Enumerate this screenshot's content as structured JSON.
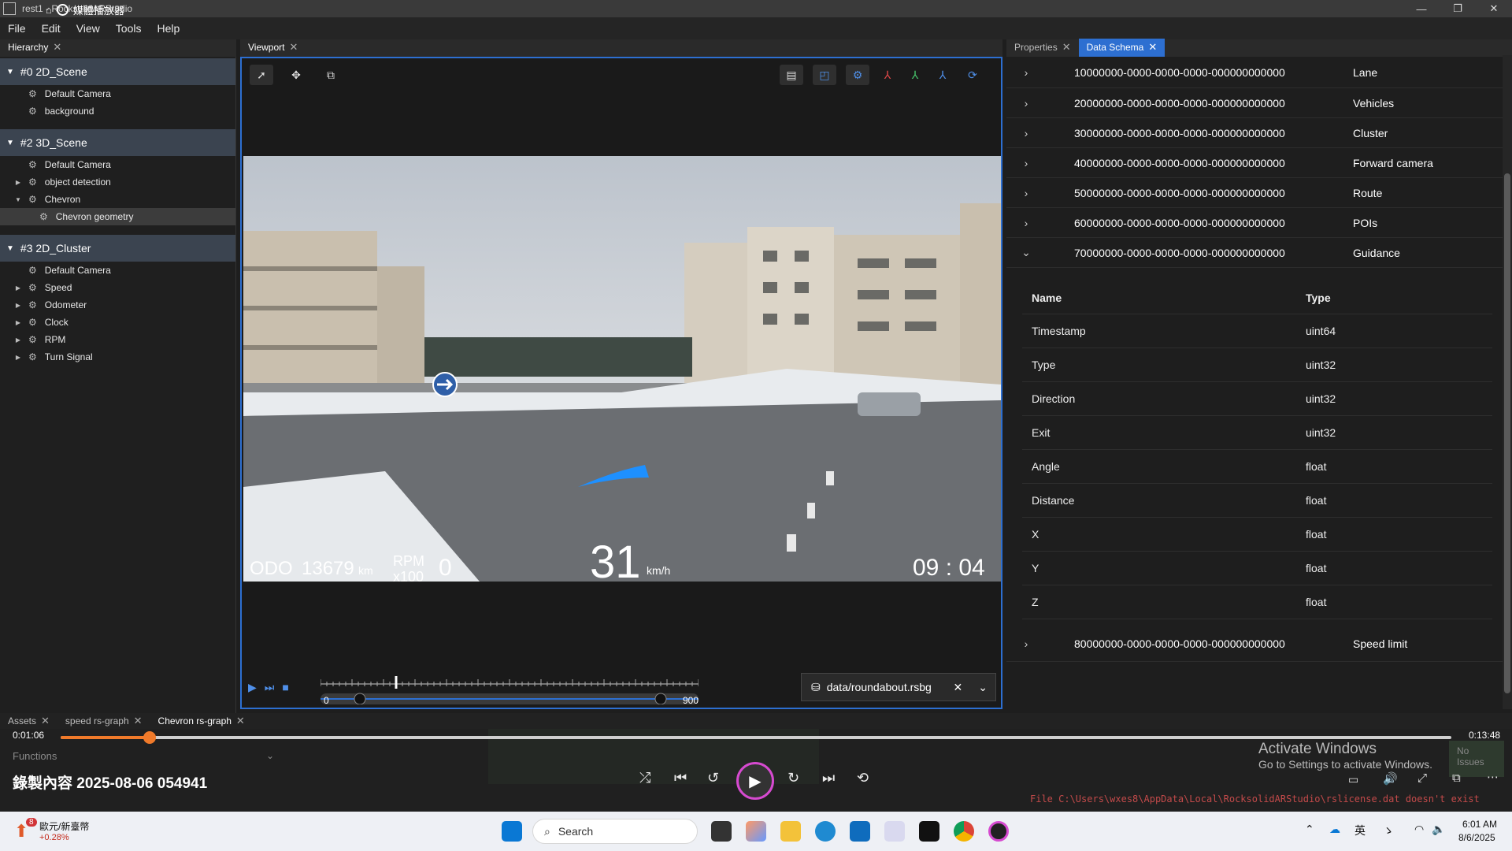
{
  "titlebar": {
    "title": "rest1 - RocksolidARStudio",
    "overlay_text": "媒體播放器"
  },
  "menu": [
    "File",
    "Edit",
    "View",
    "Tools",
    "Help"
  ],
  "hierarchy": {
    "tab": "Hierarchy",
    "scenes": [
      {
        "title": "#0 2D_Scene",
        "nodes": [
          {
            "label": "Default Camera",
            "expandable": false
          },
          {
            "label": "background",
            "expandable": false
          }
        ]
      },
      {
        "title": "#2 3D_Scene",
        "nodes": [
          {
            "label": "Default Camera",
            "expandable": false
          },
          {
            "label": "object detection",
            "expandable": true
          },
          {
            "label": "Chevron",
            "expandable": true,
            "expanded": true
          },
          {
            "label": "Chevron geometry",
            "expandable": false,
            "child": true,
            "selected": true
          }
        ]
      },
      {
        "title": "#3 2D_Cluster",
        "nodes": [
          {
            "label": "Default Camera",
            "expandable": false
          },
          {
            "label": "Speed",
            "expandable": true
          },
          {
            "label": "Odometer",
            "expandable": true
          },
          {
            "label": "Clock",
            "expandable": true
          },
          {
            "label": "RPM",
            "expandable": true
          },
          {
            "label": "Turn Signal",
            "expandable": true
          }
        ]
      }
    ]
  },
  "viewport": {
    "tab": "Viewport",
    "hud": {
      "odo_label": "ODO",
      "odo_value": "13679",
      "odo_unit": "km",
      "rpm_label": "RPM",
      "rpm_mult": "x100",
      "rpm_value": "0",
      "speed_value": "31",
      "speed_unit": "km/h",
      "clock": "09 : 04"
    },
    "timeline": {
      "start": "0",
      "end": "900",
      "position_fraction": 0.2
    },
    "file": "data/roundabout.rsbg"
  },
  "right_panel": {
    "tabs": [
      "Properties",
      "Data Schema"
    ],
    "active_tab": "Data Schema",
    "schemas": [
      {
        "uuid": "10000000-0000-0000-0000-000000000000",
        "name": "Lane"
      },
      {
        "uuid": "20000000-0000-0000-0000-000000000000",
        "name": "Vehicles"
      },
      {
        "uuid": "30000000-0000-0000-0000-000000000000",
        "name": "Cluster"
      },
      {
        "uuid": "40000000-0000-0000-0000-000000000000",
        "name": "Forward camera"
      },
      {
        "uuid": "50000000-0000-0000-0000-000000000000",
        "name": "Route"
      },
      {
        "uuid": "60000000-0000-0000-0000-000000000000",
        "name": "POIs"
      },
      {
        "uuid": "70000000-0000-0000-0000-000000000000",
        "name": "Guidance",
        "expanded": true
      }
    ],
    "fields_header": {
      "name": "Name",
      "type": "Type"
    },
    "fields": [
      {
        "name": "Timestamp",
        "type": "uint64"
      },
      {
        "name": "Type",
        "type": "uint32"
      },
      {
        "name": "Direction",
        "type": "uint32"
      },
      {
        "name": "Exit",
        "type": "uint32"
      },
      {
        "name": "Angle",
        "type": "float"
      },
      {
        "name": "Distance",
        "type": "float"
      },
      {
        "name": "X",
        "type": "float"
      },
      {
        "name": "Y",
        "type": "float"
      },
      {
        "name": "Z",
        "type": "float"
      }
    ],
    "last_schema": {
      "uuid": "80000000-0000-0000-0000-000000000000",
      "name": "Speed limit"
    }
  },
  "bottom": {
    "tabs": [
      "Assets",
      "speed rs-graph",
      "Chevron rs-graph"
    ],
    "functions_label": "Functions",
    "elapsed": "0:01:06",
    "duration": "0:13:48",
    "progress_fraction": 0.064,
    "recording_title": "錄製內容 2025-08-06 054941",
    "activate_title": "Activate Windows",
    "activate_sub": "Go to Settings to activate Windows.",
    "no_issues": "No Issues",
    "error_line": "File C:\\Users\\wxes8\\AppData\\Local\\RocksolidARStudio\\rslicense.dat doesn't exist"
  },
  "taskbar": {
    "stock_name": "歐元/新臺幣",
    "stock_change": "+0.28%",
    "badge": "8",
    "search_placeholder": "Search",
    "ime": "英",
    "time": "6:01 AM",
    "date": "8/6/2025"
  }
}
